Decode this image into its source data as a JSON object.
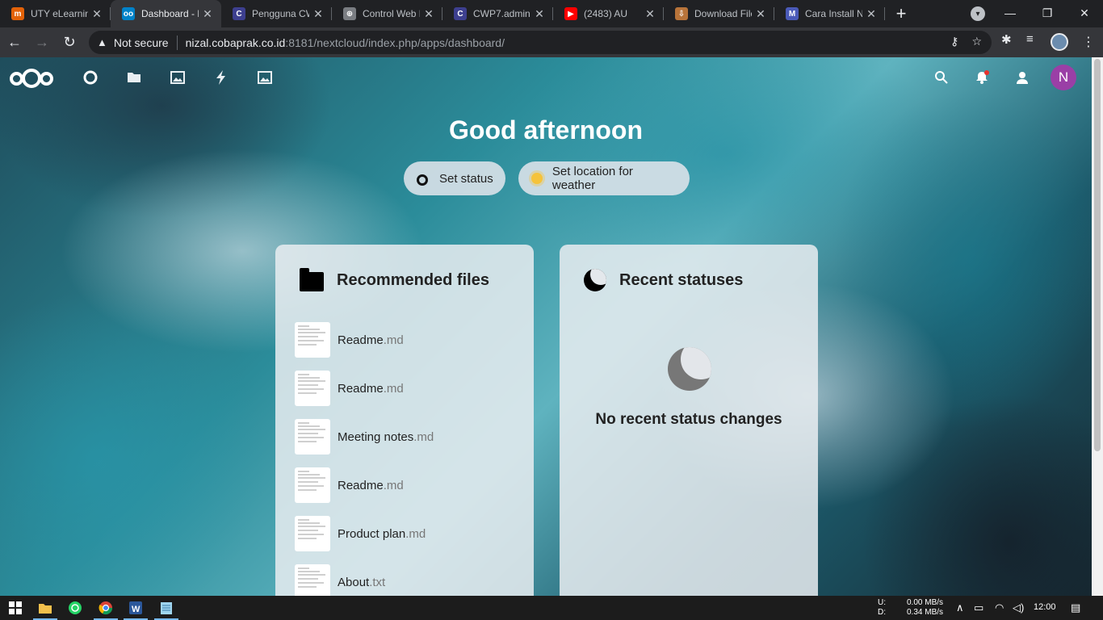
{
  "browser": {
    "tabs": [
      {
        "title": "UTY eLearning",
        "favicon_color": "#e36209",
        "favicon_text": "m"
      },
      {
        "title": "Dashboard - N",
        "favicon_color": "#0082c9",
        "favicon_text": "oo",
        "active": true
      },
      {
        "title": "Pengguna CW",
        "favicon_color": "#3d3f8f",
        "favicon_text": "C"
      },
      {
        "title": "Control Web P",
        "favicon_color": "#7a7d82",
        "favicon_text": "⊕"
      },
      {
        "title": "CWP7.admin",
        "favicon_color": "#3d3f8f",
        "favicon_text": "C"
      },
      {
        "title": "(2483) AU",
        "favicon_color": "#ff0000",
        "favicon_text": "▶"
      },
      {
        "title": "Download File",
        "favicon_color": "#b8743a",
        "favicon_text": "⇩"
      },
      {
        "title": "Cara Install Ne",
        "favicon_color": "#4a5ab8",
        "favicon_text": "M"
      }
    ],
    "address": {
      "security_label": "Not secure",
      "host": "nizal.cobaprak.co.id",
      "rest": ":8181/nextcloud/index.php/apps/dashboard/"
    }
  },
  "nextcloud": {
    "avatar_initial": "N",
    "greeting": "Good afternoon",
    "set_status_label": "Set status",
    "weather_label": "Set location for weather",
    "recommended": {
      "title": "Recommended files",
      "files": [
        {
          "name": "Readme",
          "ext": ".md"
        },
        {
          "name": "Readme",
          "ext": ".md"
        },
        {
          "name": "Meeting notes",
          "ext": ".md"
        },
        {
          "name": "Readme",
          "ext": ".md"
        },
        {
          "name": "Product plan",
          "ext": ".md"
        },
        {
          "name": "About",
          "ext": ".txt"
        }
      ]
    },
    "statuses": {
      "title": "Recent statuses",
      "empty_message": "No recent status changes"
    }
  },
  "taskbar": {
    "upload_label": "U:",
    "upload_speed": "0.00 MB/s",
    "download_label": "D:",
    "download_speed": "0.34 MB/s",
    "time": "12:00"
  }
}
